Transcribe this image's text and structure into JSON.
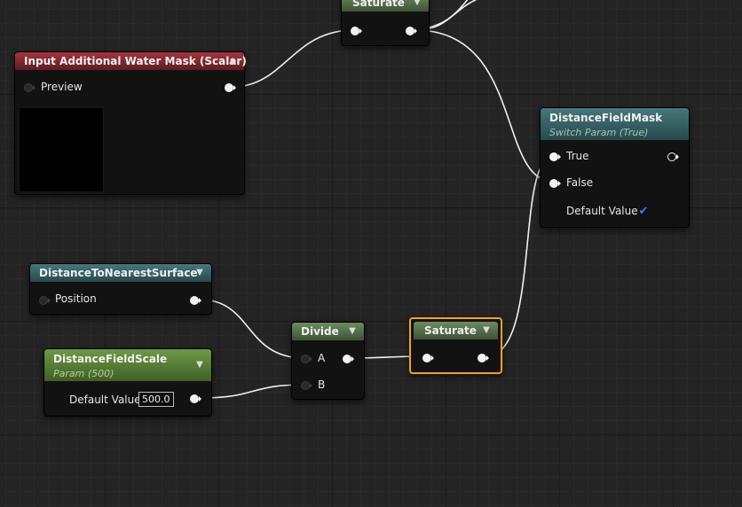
{
  "nodes": {
    "saturate_top": {
      "title": "Saturate"
    },
    "water_mask": {
      "title": "Input Additional Water Mask (Scalar)",
      "preview_label": "Preview"
    },
    "distance_field_mask": {
      "title": "DistanceFieldMask",
      "subtitle": "Switch Param (True)",
      "true_label": "True",
      "false_label": "False",
      "default_label": "Default Value",
      "default_checked": true
    },
    "distance_to_surface": {
      "title": "DistanceToNearestSurface",
      "position_label": "Position"
    },
    "divide": {
      "title": "Divide",
      "a_label": "A",
      "b_label": "B"
    },
    "saturate_selected": {
      "title": "Saturate",
      "selected": true
    },
    "distance_field_scale": {
      "title": "DistanceFieldScale",
      "subtitle": "Param (500)",
      "default_label": "Default Value",
      "default_value": "500.0"
    }
  },
  "icons": {
    "collapse": "chevron-down-icon",
    "collapse_up": "chevron-up-icon",
    "checkbox": "checkmark-icon",
    "pin": "exec-pin-icon"
  },
  "colors": {
    "background": "#252424",
    "selection": "#f3a31a",
    "header_green": "#4f6a45",
    "header_teal": "#305a5d",
    "header_red": "#7a2a30",
    "header_lime": "#507a34",
    "checkbox": "#3a7cff"
  }
}
